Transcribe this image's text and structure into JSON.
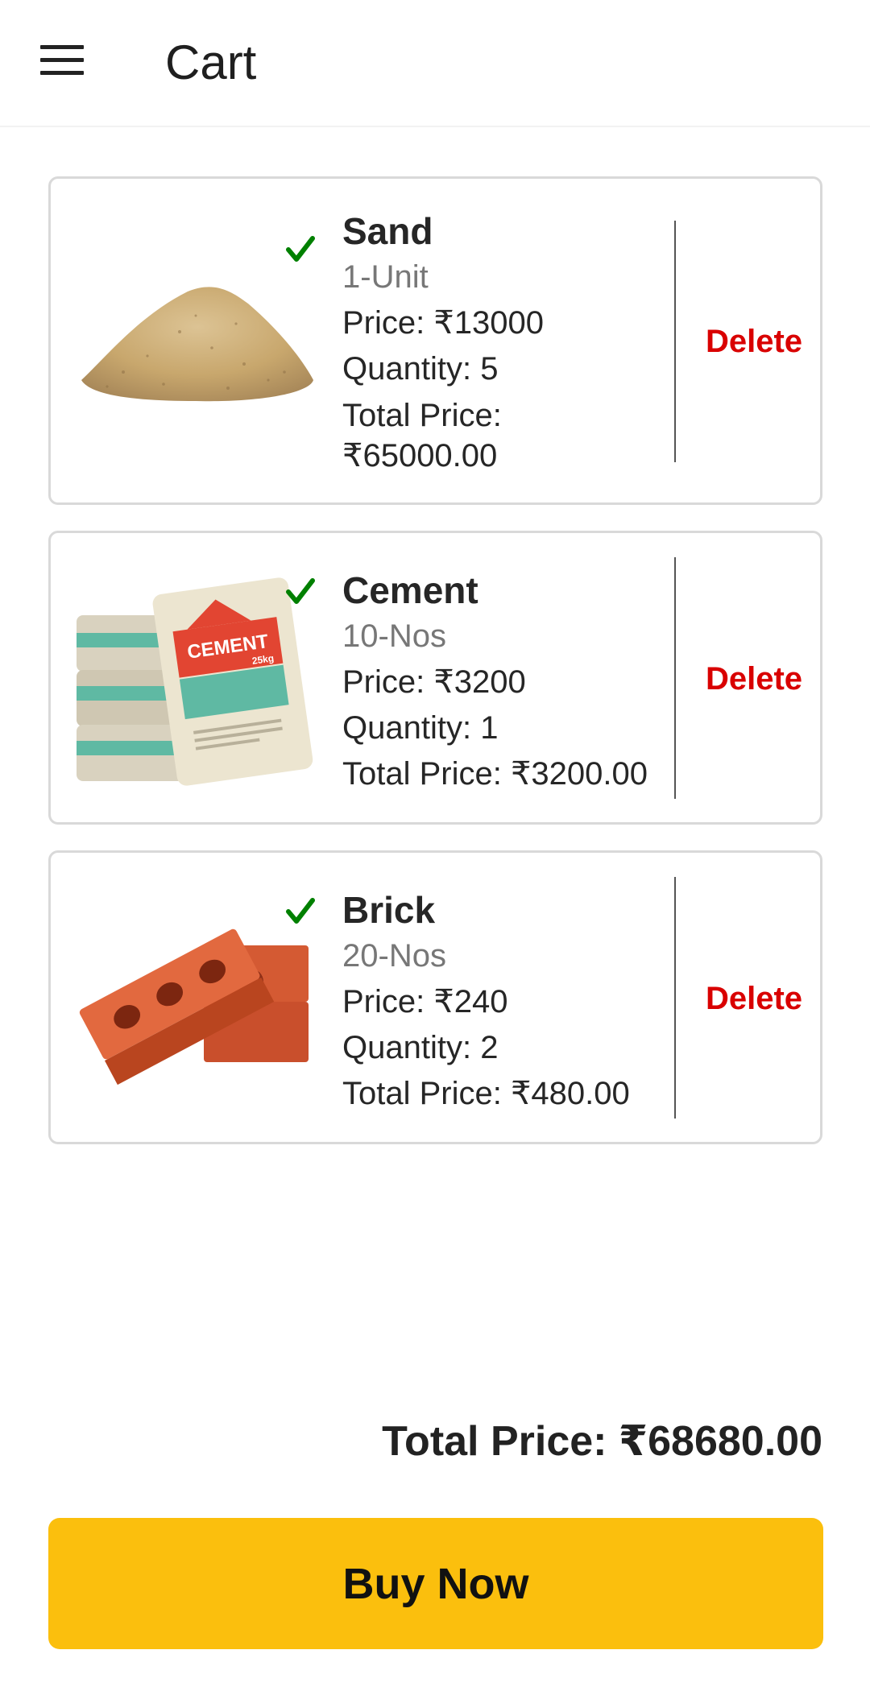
{
  "header": {
    "menu_icon": "hamburger-menu-icon",
    "title": "Cart"
  },
  "cart": {
    "items": [
      {
        "name": "Sand",
        "unit": "1-Unit",
        "price": "Price: ₹13000",
        "quantity": "Quantity: 5",
        "total_label": "Total Price:",
        "total_value": "₹65000.00",
        "delete_label": "Delete",
        "selected": true,
        "image": "sand-pile"
      },
      {
        "name": "Cement",
        "unit": "10-Nos",
        "price": "Price: ₹3200",
        "quantity": "Quantity: 1",
        "total": "Total Price: ₹3200.00",
        "delete_label": "Delete",
        "selected": true,
        "image": "cement-bags",
        "image_text": [
          "CEMENT",
          "25kg"
        ]
      },
      {
        "name": "Brick",
        "unit": "20-Nos",
        "price": "Price: ₹240",
        "quantity": "Quantity: 2",
        "total": "Total Price: ₹480.00",
        "delete_label": "Delete",
        "selected": true,
        "image": "bricks"
      }
    ]
  },
  "summary": {
    "total": "Total Price: ₹68680.00",
    "buy_label": "Buy Now"
  },
  "colors": {
    "accent": "#FBBF0D",
    "delete": "#D90000",
    "check": "#008000",
    "card_border": "#D9D9D9"
  }
}
